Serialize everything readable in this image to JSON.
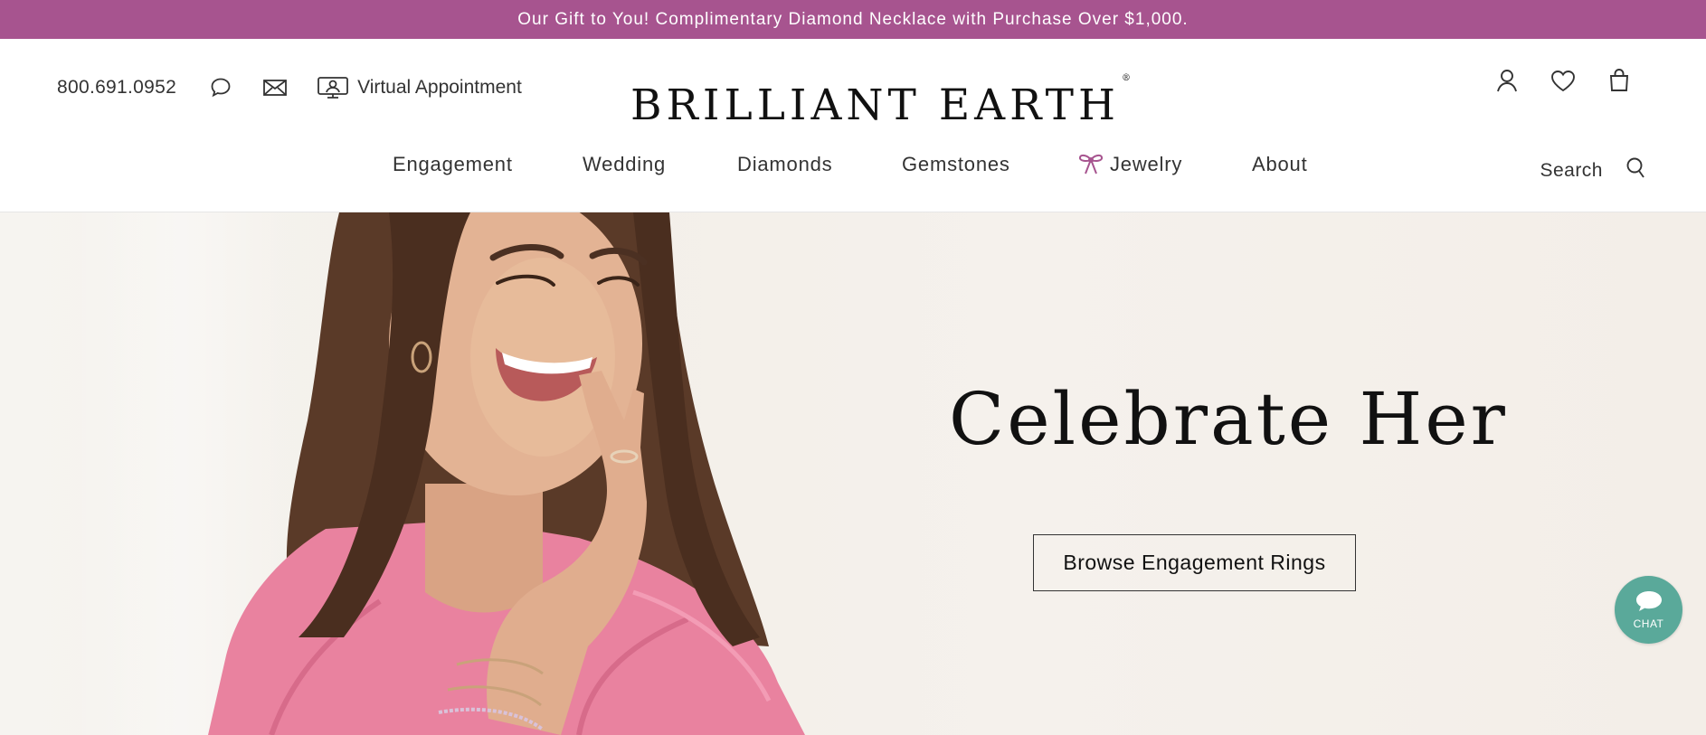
{
  "promo": {
    "text": "Our Gift to You! Complimentary Diamond Necklace with Purchase Over $1,000."
  },
  "header": {
    "phone": "800.691.0952",
    "virtual_appointment": "Virtual Appointment",
    "logo": "BRILLIANT EARTH",
    "logo_mark": "®",
    "icons": {
      "chat": "chat-bubble-icon",
      "email": "envelope-icon",
      "virtual": "video-monitor-icon",
      "account": "user-icon",
      "wishlist": "heart-icon",
      "bag": "shopping-bag-icon",
      "search": "search-icon"
    }
  },
  "nav": {
    "items": [
      {
        "label": "Engagement"
      },
      {
        "label": "Wedding"
      },
      {
        "label": "Diamonds"
      },
      {
        "label": "Gemstones"
      },
      {
        "label": "Jewelry",
        "icon": "bow-icon"
      },
      {
        "label": "About"
      }
    ],
    "search_label": "Search"
  },
  "hero": {
    "title": "Celebrate Her",
    "cta": "Browse Engagement Rings"
  },
  "chat_widget": {
    "label": "CHAT"
  },
  "colors": {
    "promo_bg": "#a7548f",
    "bow_accent": "#a7548f",
    "chat_bg": "#5aa99a",
    "hero_bg": "#f4f0eb",
    "blouse": "#e9829f"
  }
}
